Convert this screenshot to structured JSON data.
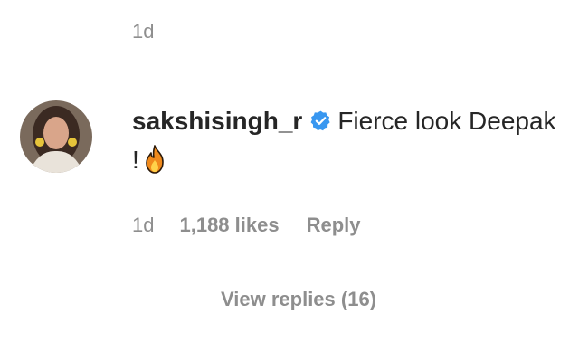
{
  "previous_comment": {
    "time": "1d"
  },
  "comment": {
    "username": "sakshisingh_r",
    "verified": true,
    "text": "Fierce look Deepak !",
    "emoji_icon": "fire-icon",
    "time": "1d",
    "likes": "1,188 likes",
    "reply_label": "Reply"
  },
  "replies": {
    "label": "View replies (16)"
  },
  "colors": {
    "text": "#262626",
    "secondary": "#8e8e8e",
    "verified_badge": "#3897f0"
  }
}
